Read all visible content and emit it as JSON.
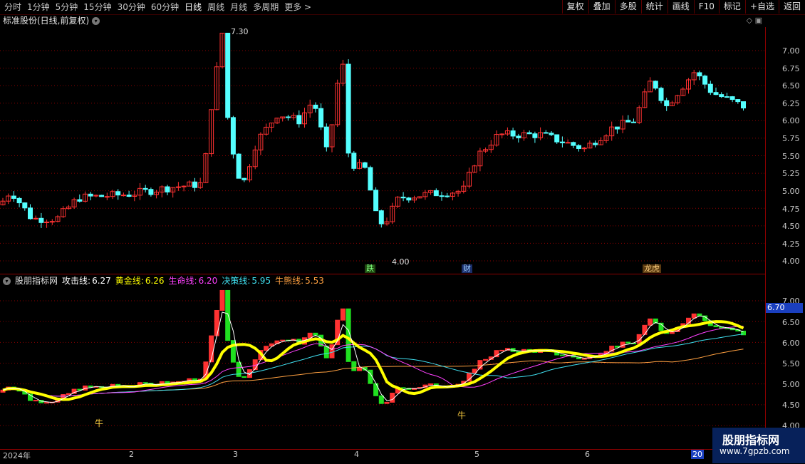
{
  "toolbar": {
    "periods": [
      "分时",
      "1分钟",
      "5分钟",
      "15分钟",
      "30分钟",
      "60分钟",
      "日线",
      "周线",
      "月线",
      "多周期",
      "更多 >"
    ],
    "active": "日线",
    "tools": [
      "复权",
      "叠加",
      "多股",
      "统计",
      "画线",
      "F10",
      "标记",
      "+自选",
      "返回"
    ]
  },
  "stock": {
    "title": "标准股份(日线,前复权)"
  },
  "price_axis": [
    "7.00",
    "6.75",
    "6.50",
    "6.25",
    "6.00",
    "5.75",
    "5.50",
    "5.25",
    "5.00",
    "4.75",
    "4.50",
    "4.25",
    "4.00"
  ],
  "annotations": {
    "high": "7.30",
    "low": "4.00",
    "tag_die": "跌",
    "tag_cai": "财",
    "tag_long": "龙虎"
  },
  "indicator": {
    "name": "股朋指标网",
    "lines": [
      {
        "label": "攻击线:",
        "value": "6.27",
        "color": "#ffffff"
      },
      {
        "label": "黄金线:",
        "value": "6.26",
        "color": "#ffff00"
      },
      {
        "label": "生命线:",
        "value": "6.20",
        "color": "#ff40ff"
      },
      {
        "label": "决策线:",
        "value": "5.95",
        "color": "#40e0f0"
      },
      {
        "label": "牛熊线:",
        "value": "5.53",
        "color": "#ffa040"
      }
    ],
    "axis": [
      "7.00",
      "6.50",
      "6.00",
      "5.50",
      "5.00",
      "4.50",
      "4.00"
    ],
    "current": "6.70",
    "niu": "牛"
  },
  "time_axis": [
    "2024年",
    "2",
    "3",
    "4",
    "5",
    "6",
    "20"
  ],
  "watermark": {
    "title": "股朋指标网",
    "url": "www.7gpzb.com"
  },
  "colors": {
    "up": "#ff3232",
    "down": "#54ffff",
    "grid": "#8b0000"
  }
}
